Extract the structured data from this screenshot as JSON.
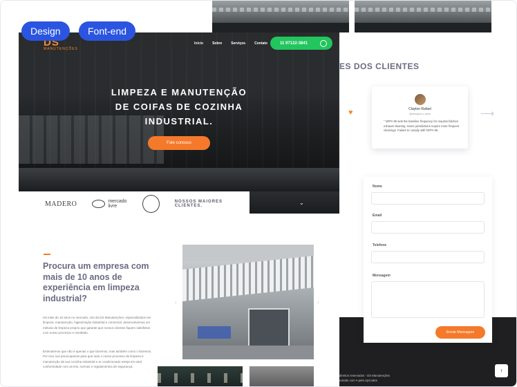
{
  "tags": {
    "design": "Design",
    "frontend": "Font-end"
  },
  "hero": {
    "logo_mark": "DS",
    "logo_sub": "MANUTENÇÕES",
    "nav": [
      "Início",
      "Sobre",
      "Serviços",
      "Contato"
    ],
    "phone": "11 97122-3841",
    "title_lines": [
      "LIMPEZA E MANUTENÇÃO",
      "DE COIFAS DE COZINHA",
      "INDUSTRIAL."
    ],
    "cta": "Fale conosco"
  },
  "clients": {
    "madero": "MADERO",
    "mercado": [
      "mercado",
      "livre"
    ],
    "badge": "",
    "label": "NOSSOS MAIORES CLIENTES."
  },
  "testimonials": {
    "title": "ES DOS CLIENTES",
    "name": "Clayton Rafael",
    "role": "@diclaydo.c.silva",
    "text": "NFPA 96 sets the baseline frequency for required kitchen exhaust cleaning. Some jurisdictions require more frequent cleanings. Failure to comply with NFPA 96."
  },
  "form": {
    "fields": [
      "Nome",
      "Email",
      "Telefone",
      "Mensagem"
    ],
    "submit": "Enviar Mensagem"
  },
  "footer": {
    "line1": "direitos reservados - DS Manutenções",
    "line2": "volvido com",
    "line2_end": "pela UpCodes"
  },
  "about": {
    "title": "Procura um empresa com mais de 10 anos de experiência em limpeza industrial?",
    "p1": "Há mais de 10 anos no mercado, nós da DS Manutenções, especializados em limpeza, manutenção, higienização industrial e comercial, desenvolvemos um método de limpeza próprio que garante que nossos clientes fiquem satisfeitos com nosso processo e resultado.",
    "p2": "Entendemos que não é apenas o que fazemos, mas também como o fazemos. Por isso nos preocupamos para que todo o nosso processo de limpeza e manutenção da sua cozinha industrial e ar condicionado esteja em total conformidade com as leis, normas e regulamentos de segurança."
  },
  "colors": {
    "accent": "#f5792b",
    "tag": "#2b55e0",
    "whatsapp": "#22c55e",
    "heading": "#6a6a84"
  },
  "icons": [
    "whatsapp-icon",
    "heart-icon",
    "arrow-right-icon",
    "chevron-down-icon",
    "arrow-up-icon",
    "chevron-left-icon",
    "chevron-right-icon"
  ]
}
